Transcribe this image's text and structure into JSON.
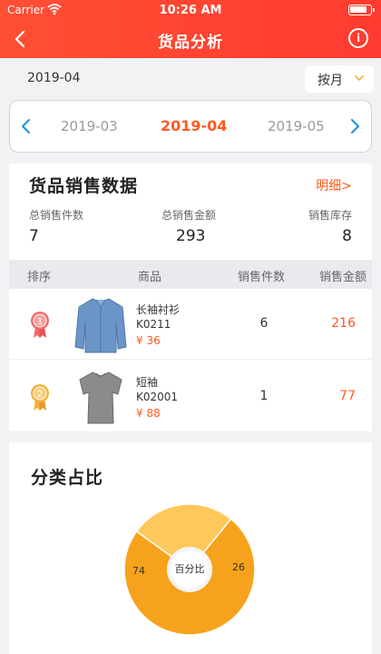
{
  "status_bar": {
    "carrier": "Carrier",
    "time": "10:26 AM"
  },
  "nav": {
    "title": "货品分析",
    "info_glyph": "i"
  },
  "month_row": {
    "current": "2019-04",
    "period_label": "按月"
  },
  "month_selector": {
    "prev": "2019-03",
    "active": "2019-04",
    "next": "2019-05"
  },
  "sales": {
    "title": "货品销售数据",
    "detail_link": "明细>",
    "stats": [
      {
        "label": "总销售件数",
        "value": "7"
      },
      {
        "label": "总销售金额",
        "value": "293"
      },
      {
        "label": "销售库存",
        "value": "8"
      }
    ],
    "columns": [
      "排序",
      "商品",
      "销售件数",
      "销售金额"
    ],
    "rows": [
      {
        "rank": "1",
        "name": "长袖衬衫",
        "code": "K0211",
        "price": "¥ 36",
        "count": "6",
        "amount": "216",
        "badge_color": "#f06b6b",
        "item_color": "#6b95c8"
      },
      {
        "rank": "2",
        "name": "短袖",
        "code": "K02001",
        "price": "¥ 88",
        "count": "1",
        "amount": "77",
        "badge_color": "#f5b13d",
        "item_color": "#8b8b8d"
      }
    ]
  },
  "category": {
    "title": "分类占比",
    "center_label": "百分比",
    "slices": [
      {
        "value": 74,
        "label": "74",
        "color": "#f7a21c"
      },
      {
        "value": 26,
        "label": "26",
        "color": "#ffc85a"
      }
    ]
  },
  "colors": {
    "accent": "#ff5a1f",
    "header": "#ff4433"
  }
}
